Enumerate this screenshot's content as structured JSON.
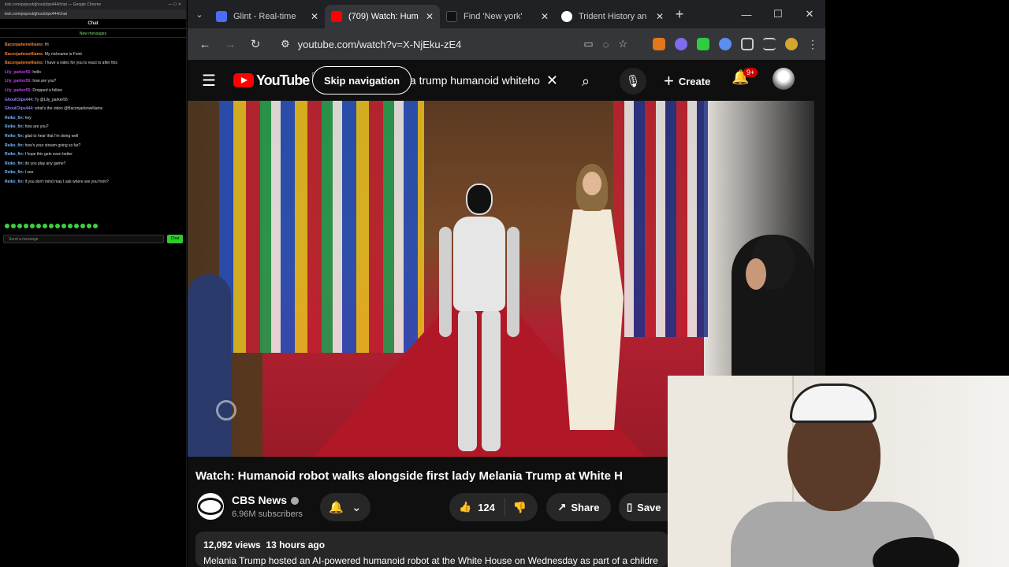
{
  "chat": {
    "window_title": "kick.com/popout/ghoulclips444/chat — Google Chrome",
    "url": "kick.com/popout/ghoulclips444/chat",
    "title": "Chat",
    "new_messages": "New messages",
    "messages": [
      {
        "user": "Baconjadenwilliams:",
        "text": "Hi",
        "color": "#f08030"
      },
      {
        "user": "Baconjadenwilliams:",
        "text": "My nickname is Foint",
        "color": "#f08030"
      },
      {
        "user": "Baconjadenwilliams:",
        "text": "I have a video for you to react to after this",
        "color": "#f08030"
      },
      {
        "user": "Lily_parker55:",
        "text": "hello",
        "color": "#c040f0"
      },
      {
        "user": "Lily_parker55:",
        "text": "how are you?",
        "color": "#c040f0"
      },
      {
        "user": "Lily_parker55:",
        "text": "Dropped a follow",
        "color": "#c040f0"
      },
      {
        "user": "GhoulClips444:",
        "text": "Ty @Lily_parker55",
        "color": "#9a7fff"
      },
      {
        "user": "GhoulClips444:",
        "text": "what's the video @Baconjadenwilliams",
        "color": "#9a7fff"
      },
      {
        "user": "Reiko_fin:",
        "text": "hey",
        "color": "#7ab8ff"
      },
      {
        "user": "Reiko_fin:",
        "text": "how are you?",
        "color": "#7ab8ff"
      },
      {
        "user": "Reiko_fin:",
        "text": "glad to hear that I'm doing well",
        "color": "#7ab8ff"
      },
      {
        "user": "Reiko_fin:",
        "text": "how's your stream going so far?",
        "color": "#7ab8ff"
      },
      {
        "user": "Reiko_fin:",
        "text": "I hope this gets even better",
        "color": "#7ab8ff"
      },
      {
        "user": "Reiko_fin:",
        "text": "do you play any game?",
        "color": "#7ab8ff"
      },
      {
        "user": "Reiko_fin:",
        "text": "I see",
        "color": "#7ab8ff"
      },
      {
        "user": "Reiko_fin:",
        "text": "if you don't mind may I ask where are you from?",
        "color": "#7ab8ff"
      }
    ],
    "send_placeholder": "Send a message",
    "send_label": "Chat"
  },
  "browser": {
    "tabs": [
      {
        "title": "Glint - Real-time",
        "favicon_color": "#4a6cf7",
        "active": false
      },
      {
        "title": "(709) Watch: Hum",
        "favicon_color": "#ff0000",
        "active": true
      },
      {
        "title": "Find 'New york'",
        "favicon_color": "#111111",
        "active": false
      },
      {
        "title": "Trident History an",
        "favicon_color": "#ffffff",
        "active": false
      }
    ],
    "address": "youtube.com/watch?v=X-NjEku-zE4"
  },
  "youtube": {
    "logo_text": "YouTube",
    "country": "DE",
    "skip_nav": "Skip navigation",
    "search_query": "nia trump humanoid whiteho",
    "create_label": "Create",
    "notif_badge": "9+",
    "video_title": "Watch: Humanoid robot walks alongside first lady Melania Trump at White H",
    "channel_name": "CBS News",
    "subscribers": "6.96M subscribers",
    "likes": "124",
    "share_label": "Share",
    "save_label": "Save",
    "views": "12,092 views",
    "age": "13 hours ago",
    "description": "Melania Trump hosted an AI-powered humanoid robot at the White House on Wednesday as part of a childre"
  }
}
